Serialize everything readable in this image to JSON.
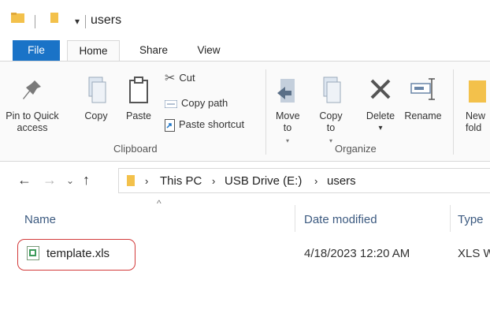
{
  "titlebar": {
    "title": "users",
    "quick_access_icon": "folder-icon",
    "pin_icon": "dropdown-pin-icon"
  },
  "tabs": [
    {
      "label": "File",
      "active": false
    },
    {
      "label": "Home",
      "active": true
    },
    {
      "label": "Share",
      "active": false
    },
    {
      "label": "View",
      "active": false
    }
  ],
  "ribbon": {
    "clipboard": {
      "pin_label": "Pin to Quick access",
      "copy_label": "Copy",
      "paste_label": "Paste",
      "cut_label": "Cut",
      "copy_path_label": "Copy path",
      "paste_shortcut_label": "Paste shortcut",
      "group_label": "Clipboard"
    },
    "organize": {
      "move_to_label": "Move to",
      "copy_to_label": "Copy to",
      "delete_label": "Delete",
      "rename_label": "Rename",
      "group_label": "Organize"
    },
    "new": {
      "new_folder_label": "New fold"
    }
  },
  "address": {
    "crumbs": [
      "This PC",
      "USB Drive (E:)",
      "users"
    ]
  },
  "columns": {
    "name": "Name",
    "date_modified": "Date modified",
    "type": "Type"
  },
  "files": [
    {
      "name": "template.xls",
      "date_modified": "4/18/2023 12:20 AM",
      "type": "XLS W"
    }
  ],
  "colors": {
    "file_tab": "#1a73c7",
    "highlight": "#d23a3a",
    "column_header_text": "#3c5a80",
    "folder_yellow": "#f3c14b"
  }
}
